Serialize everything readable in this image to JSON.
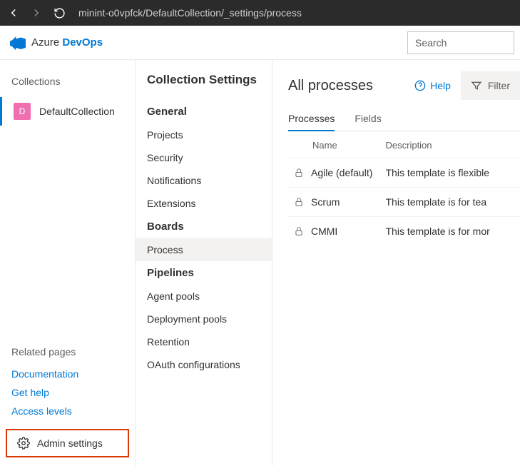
{
  "browser": {
    "url": "minint-o0vpfck/DefaultCollection/_settings/process"
  },
  "brand": {
    "light": "Azure ",
    "strong": "DevOps"
  },
  "search": {
    "placeholder": "Search"
  },
  "left": {
    "collections_label": "Collections",
    "collection": {
      "initial": "D",
      "name": "DefaultCollection"
    },
    "related_label": "Related pages",
    "links": {
      "documentation": "Documentation",
      "get_help": "Get help",
      "access_levels": "Access levels"
    },
    "admin_settings": "Admin settings"
  },
  "settings": {
    "title": "Collection Settings",
    "groups": {
      "general": {
        "head": "General",
        "items": {
          "projects": "Projects",
          "security": "Security",
          "notifications": "Notifications",
          "extensions": "Extensions"
        }
      },
      "boards": {
        "head": "Boards",
        "items": {
          "process": "Process"
        }
      },
      "pipelines": {
        "head": "Pipelines",
        "items": {
          "agent_pools": "Agent pools",
          "deployment_pools": "Deployment pools",
          "retention": "Retention",
          "oauth": "OAuth configurations"
        }
      }
    }
  },
  "main": {
    "title": "All processes",
    "help_label": "Help",
    "filter_label": "Filter",
    "tabs": {
      "processes": "Processes",
      "fields": "Fields"
    },
    "columns": {
      "name": "Name",
      "description": "Description"
    },
    "rows": [
      {
        "name": "Agile (default)",
        "description": "This template is flexible"
      },
      {
        "name": "Scrum",
        "description": "This template is for tea"
      },
      {
        "name": "CMMI",
        "description": "This template is for mor"
      }
    ]
  }
}
